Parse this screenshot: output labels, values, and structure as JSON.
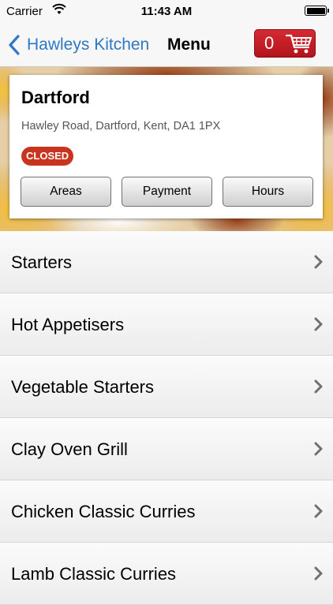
{
  "status_bar": {
    "carrier": "Carrier",
    "time": "11:43 AM"
  },
  "nav": {
    "back_label": "Hawleys Kitchen",
    "title": "Menu",
    "cart_count": "0"
  },
  "store": {
    "name": "Dartford",
    "address": "Hawley Road, Dartford, Kent, DA1 1PX",
    "status": "CLOSED",
    "buttons": {
      "areas": "Areas",
      "payment": "Payment",
      "hours": "Hours"
    }
  },
  "menu": {
    "items": [
      {
        "label": "Starters"
      },
      {
        "label": "Hot Appetisers"
      },
      {
        "label": "Vegetable Starters"
      },
      {
        "label": "Clay Oven Grill"
      },
      {
        "label": "Chicken Classic Curries"
      },
      {
        "label": "Lamb Classic Curries"
      }
    ]
  },
  "colors": {
    "accent_blue": "#2f78c4",
    "cart_red": "#c41e26",
    "closed_badge": "#c9341e"
  },
  "icons": [
    "wifi-icon",
    "battery-icon",
    "back-chevron-icon",
    "cart-icon",
    "chevron-right-icon"
  ]
}
